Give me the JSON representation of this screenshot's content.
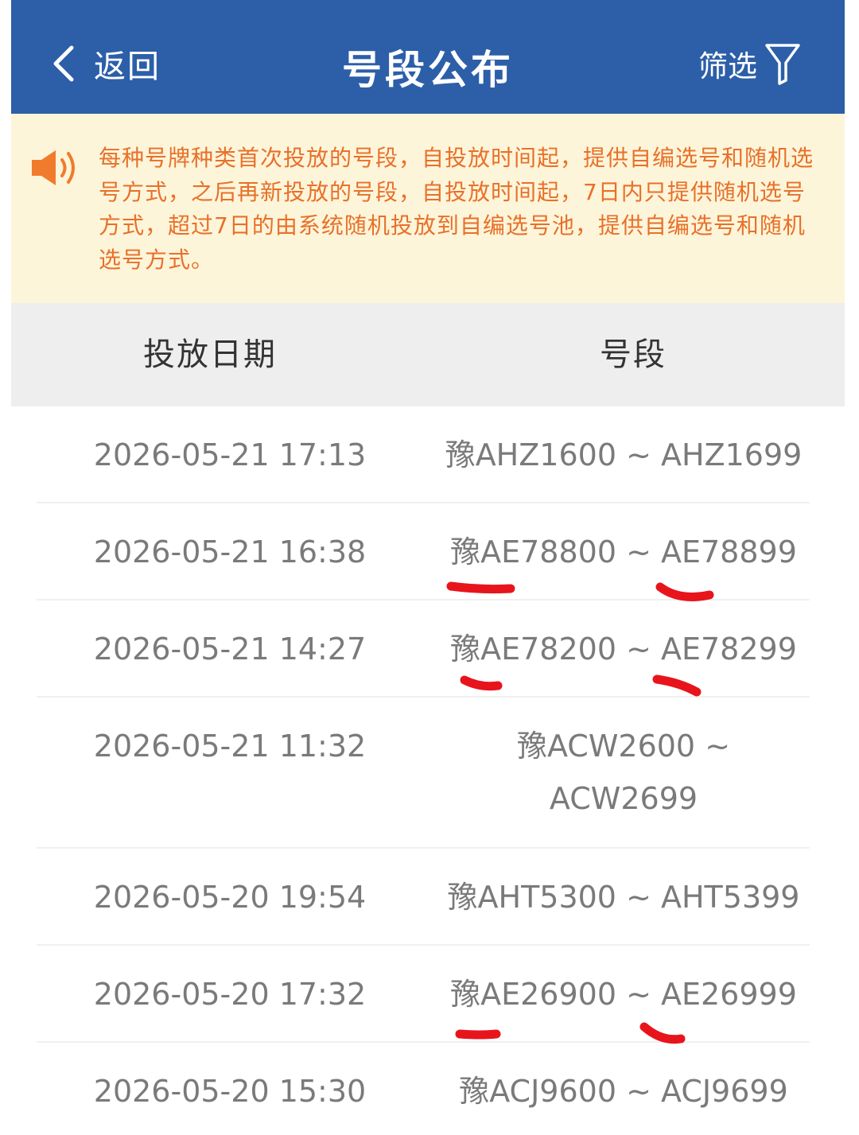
{
  "header": {
    "back_label": "返回",
    "title": "号段公布",
    "filter_label": "筛选",
    "bg_color": "#2c5fa8"
  },
  "notice": {
    "icon": "speaker-icon",
    "text": "每种号牌种类首次投放的号段，自投放时间起，提供自编选号和随机选号方式，之后再新投放的号段，自投放时间起，7日内只提供随机选号方式，超过7日的由系统随机投放到自编选号池，提供自编选号和随机选号方式。",
    "text_color": "#e8702a",
    "bg_color": "#fdf5d9"
  },
  "table": {
    "columns": [
      "投放日期",
      "号段"
    ],
    "rows": [
      {
        "date": "2026-05-21 17:13",
        "segment_line1": "豫AHZ1600 ~ AHZ1699",
        "segment_line2": ""
      },
      {
        "date": "2026-05-21 16:38",
        "segment_line1": "豫AE78800 ~ AE78899",
        "segment_line2": ""
      },
      {
        "date": "2026-05-21 14:27",
        "segment_line1": "豫AE78200 ~ AE78299",
        "segment_line2": ""
      },
      {
        "date": "2026-05-21 11:32",
        "segment_line1": "豫ACW2600 ~",
        "segment_line2": "ACW2699"
      },
      {
        "date": "2026-05-20 19:54",
        "segment_line1": "豫AHT5300 ~ AHT5399",
        "segment_line2": ""
      },
      {
        "date": "2026-05-20 17:32",
        "segment_line1": "豫AE26900 ~ AE26999",
        "segment_line2": ""
      },
      {
        "date": "2026-05-20 15:30",
        "segment_line1": "豫ACJ9600 ~ ACJ9699",
        "segment_line2": ""
      }
    ]
  },
  "annotation_color": "#e8141c"
}
